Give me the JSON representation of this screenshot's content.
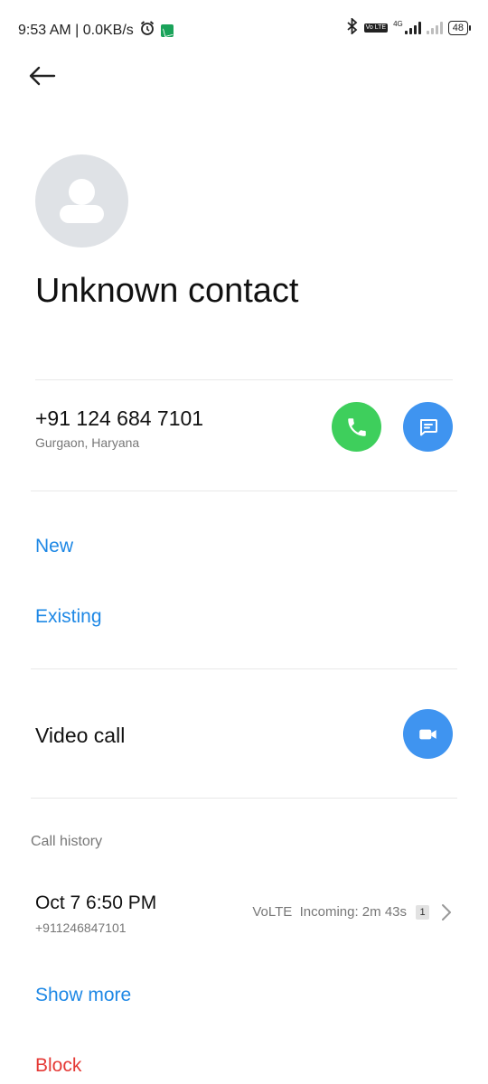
{
  "status_bar": {
    "time_speed": "9:53 AM | 0.0KB/s",
    "network_type": "4G",
    "volte_badge": "Vo LTE",
    "battery": "48"
  },
  "contact": {
    "name": "Unknown contact",
    "phone": "+91 124 684 7101",
    "location": "Gurgaon, Haryana"
  },
  "add_contact": {
    "new_label": "New",
    "existing_label": "Existing"
  },
  "video_call": {
    "label": "Video call"
  },
  "call_history": {
    "section_label": "Call history",
    "entries": [
      {
        "date": "Oct 7 6:50 PM",
        "number": "+911246847101",
        "detail": "VoLTE  Incoming: 2m 43s",
        "sim": "1"
      }
    ],
    "show_more_label": "Show more"
  },
  "actions": {
    "block_label": "Block"
  },
  "colors": {
    "accent_blue": "#1e88e5",
    "call_green": "#3ecf5c",
    "button_blue": "#3f94f0",
    "block_red": "#e53935"
  },
  "icons": [
    "back-arrow-icon",
    "phone-icon",
    "message-icon",
    "video-camera-icon",
    "chevron-right-icon",
    "alarm-icon",
    "bluetooth-icon"
  ]
}
